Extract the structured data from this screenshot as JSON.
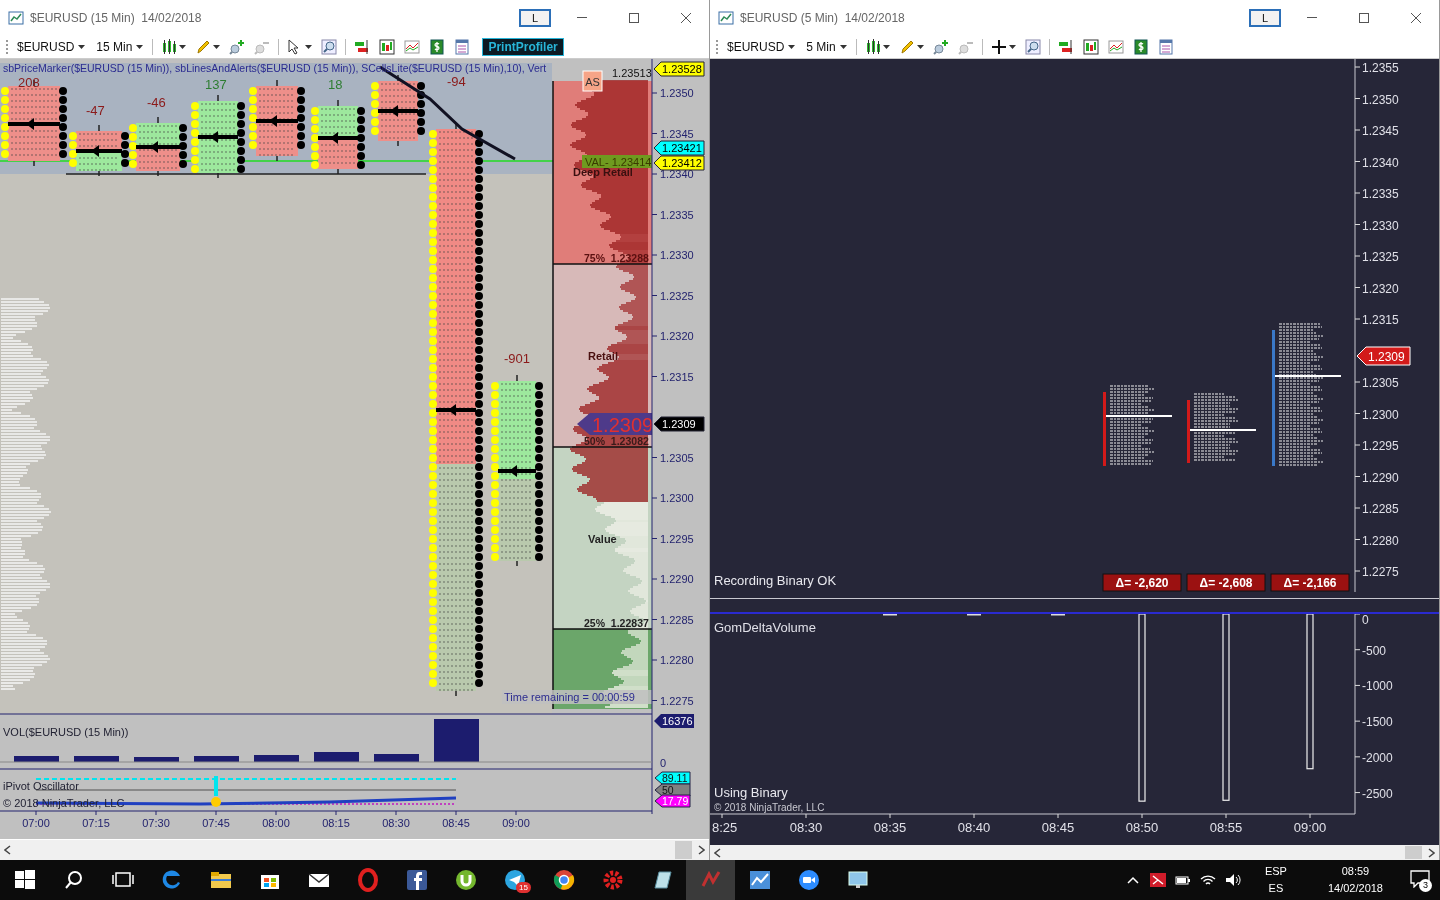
{
  "windows": [
    {
      "kind": "footprint",
      "title": "$EURUSD (15 Min)",
      "date": "14/02/2018",
      "layout_button": "L",
      "instrument": "$EURUSD",
      "interval": "15 Min",
      "print_profiler": "PrintProfiler",
      "indicator_caption": "sbPriceMarker($EURUSD (15 Min)), sbLinesAndAlerts($EURUSD (15 Min)), SCellsLite($EURUSD (15 Min),10), Vert",
      "bar_deltas": [
        {
          "text": "208",
          "color": "#8b1a1a"
        },
        {
          "text": "-47",
          "color": "#8b1a1a"
        },
        {
          "text": "-46",
          "color": "#8b1a1a"
        },
        {
          "text": "137",
          "color": "#2e7d32"
        },
        {
          "text": "18",
          "color": "#2e7d32"
        },
        {
          "text": "-94",
          "color": "#8b1a1a"
        },
        {
          "text": "-901",
          "color": "#8b1a1a"
        }
      ],
      "profile_labels": {
        "as_button": "AS",
        "high": "1.23513",
        "val": "VAL- 1.23414",
        "deep_retail": "Deep Retail",
        "p75": "75%  1.23288",
        "retail": "Retail",
        "last_price": "1.2309",
        "p50": "50%  1.23082",
        "value": "Value",
        "p25": "25%  1.22837",
        "time_remaining": "Time remaining = 00:00:59"
      },
      "price_ticks": [
        "1.2350",
        "1.2345",
        "1.2340",
        "1.2335",
        "1.2330",
        "1.2325",
        "1.2320",
        "1.2315",
        "1.2305",
        "1.2300",
        "1.2295",
        "1.2290",
        "1.2285",
        "1.2280",
        "1.2275"
      ],
      "price_markers": [
        {
          "text": "1.23528",
          "color": "#ffff00"
        },
        {
          "text": "1.23421",
          "color": "#00ffff"
        },
        {
          "text": "1.23412",
          "color": "#ffff00"
        },
        {
          "text": "1.2309",
          "color": "#000000"
        }
      ],
      "volume_panel": {
        "title": "VOL($EURUSD (15 Min))",
        "marker": "16376",
        "zero": "0"
      },
      "oscillator_panel": {
        "title": "iPivot Oscillator",
        "copyright": "© 2018 NinjaTrader, LLC",
        "markers": [
          {
            "text": "89.11",
            "color": "#00ffff"
          },
          {
            "text": "50",
            "color": "#808080"
          },
          {
            "text": "17.79",
            "color": "#ff00ff"
          }
        ]
      },
      "time_ticks": [
        "07:00",
        "07:15",
        "07:30",
        "07:45",
        "08:00",
        "08:15",
        "08:30",
        "08:45",
        "09:00"
      ]
    },
    {
      "kind": "delta",
      "title": "$EURUSD (5 Min)",
      "date": "14/02/2018",
      "layout_button": "L",
      "instrument": "$EURUSD",
      "interval": "5 Min",
      "price_ticks": [
        "1.2355",
        "1.2350",
        "1.2345",
        "1.2340",
        "1.2335",
        "1.2330",
        "1.2325",
        "1.2320",
        "1.2315",
        "1.2305",
        "1.2300",
        "1.2295",
        "1.2290",
        "1.2285",
        "1.2280",
        "1.2275"
      ],
      "price_markers": [
        {
          "text": "1.2309",
          "color": "#d21a1a"
        }
      ],
      "status": "Recording Binary OK",
      "delta_labels": [
        "Δ= -2,620",
        "Δ= -2,608",
        "Δ= -2,166"
      ],
      "delta_panel": {
        "title": "GomDeltaVolume",
        "note": "Using Binary",
        "copyright": "© 2018 NinjaTrader, LLC",
        "chart_data": {
          "type": "bar",
          "categories": [
            "8:25",
            "08:30",
            "08:35",
            "08:40",
            "08:45",
            "08:50",
            "08:55",
            "09:00"
          ],
          "values": [
            null,
            null,
            0,
            0,
            0,
            -2620,
            -2608,
            -2166
          ],
          "yticks": [
            0,
            -500,
            -1000,
            -1500,
            -2000,
            -2500
          ],
          "ylim": [
            -2800,
            0
          ]
        }
      }
    }
  ],
  "taskbar": {
    "telegram_badge": "15",
    "language": "ESP",
    "keyboard": "ES",
    "time": "08:59",
    "date": "14/02/2018",
    "notifications": "3"
  }
}
